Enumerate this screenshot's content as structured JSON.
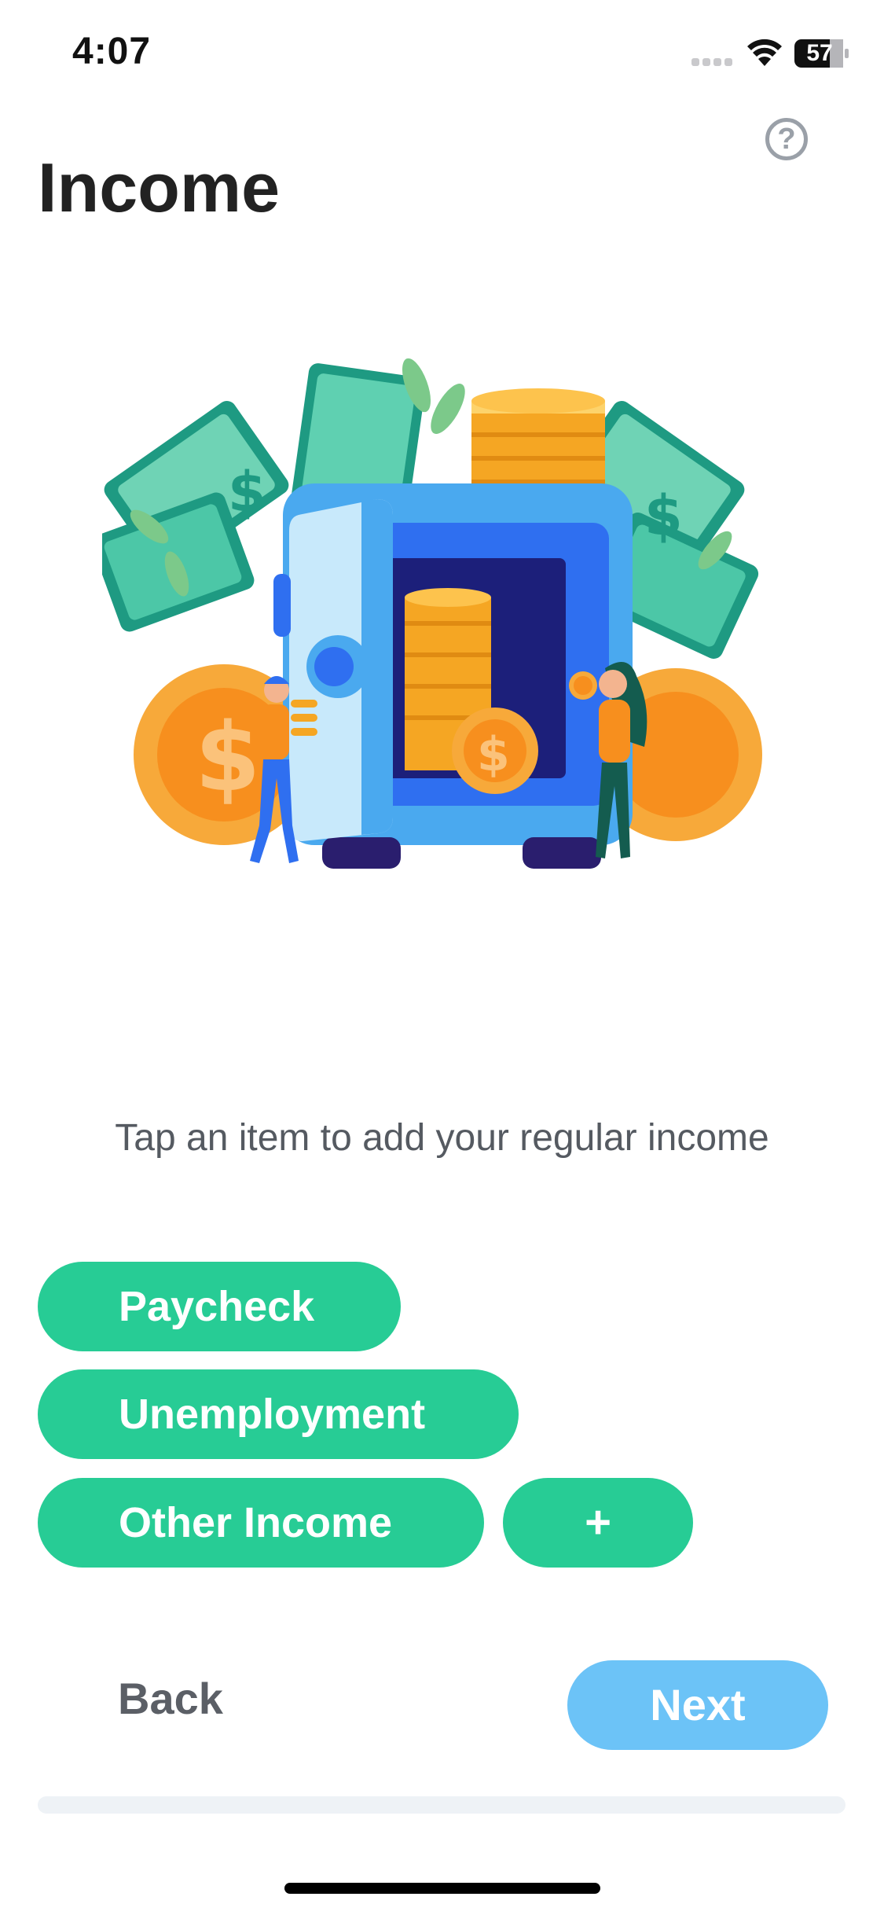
{
  "status_bar": {
    "time": "4:07",
    "battery": "57"
  },
  "header": {
    "title": "Income",
    "help_icon": "question-circle-icon"
  },
  "illustration": {
    "subject": "safe-with-coins-and-money-icon"
  },
  "instruction": "Tap an item to add your regular income",
  "income_items": [
    {
      "label": "Paycheck"
    },
    {
      "label": "Unemployment"
    },
    {
      "label": "Other Income"
    },
    {
      "label": "+"
    }
  ],
  "footer": {
    "back_label": "Back",
    "next_label": "Next"
  },
  "colors": {
    "chip": "#27cc95",
    "next_button": "#6cc3f7",
    "title": "#222222",
    "muted_text": "#555a61"
  }
}
